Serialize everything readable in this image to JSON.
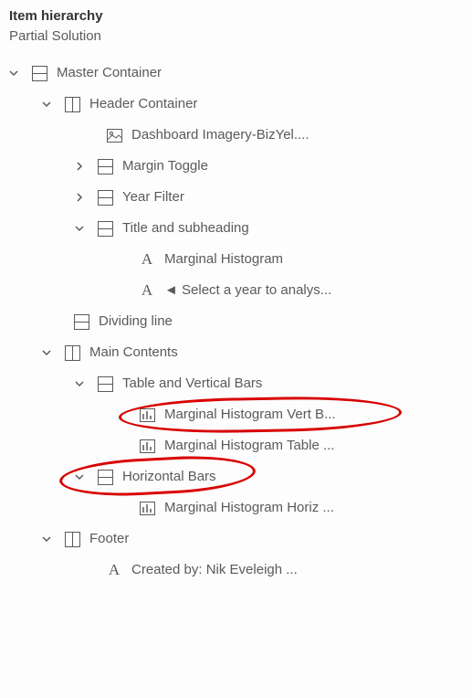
{
  "panel": {
    "title": "Item hierarchy",
    "subtitle": "Partial Solution"
  },
  "tree": {
    "master": "Master Container",
    "header": "Header Container",
    "imagery": "Dashboard Imagery-BizYel....",
    "marginToggle": "Margin Toggle",
    "yearFilter": "Year Filter",
    "titleSub": "Title and subheading",
    "mh": "Marginal Histogram",
    "selectYear": "◄ Select a year to analys...",
    "dividing": "Dividing line",
    "mainContents": "Main Contents",
    "tableVert": "Table and Vertical Bars",
    "mhVertB": "Marginal Histogram Vert B...",
    "mhTable": "Marginal Histogram Table ...",
    "horizBars": "Horizontal Bars",
    "mhHoriz": "Marginal Histogram Horiz ...",
    "footer": "Footer",
    "createdBy": "Created by: Nik Eveleigh ..."
  }
}
